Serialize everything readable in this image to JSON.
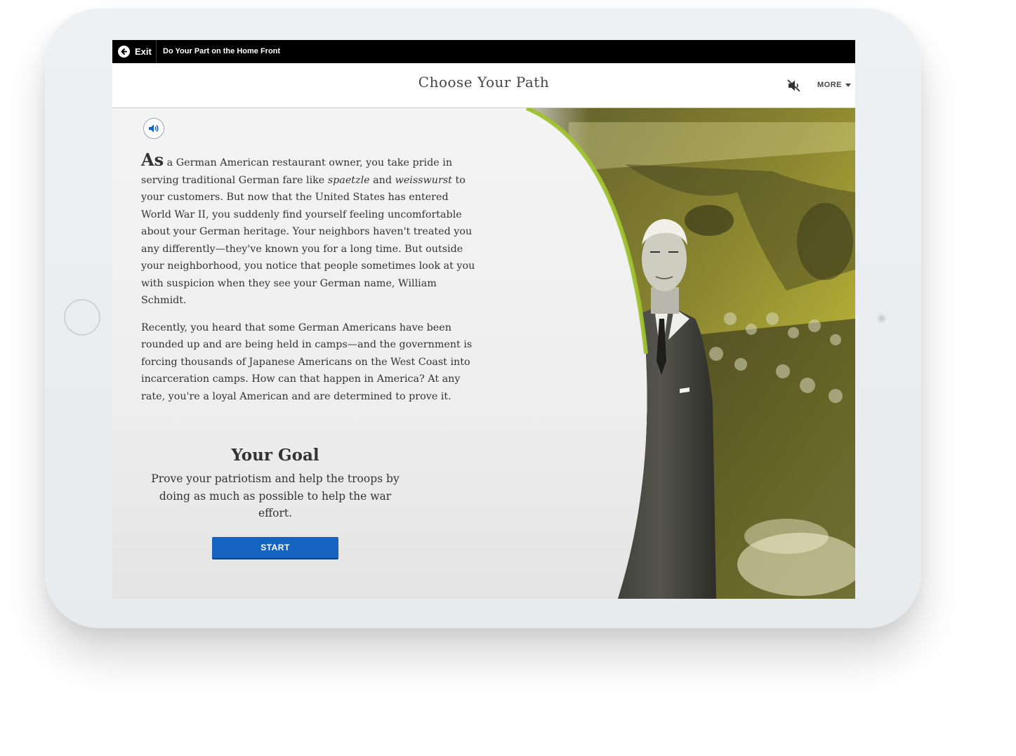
{
  "topbar": {
    "exit_label": "Exit",
    "lesson_title": "Do Your Part on the Home Front"
  },
  "header": {
    "title": "Choose Your Path",
    "more_label": "MORE"
  },
  "story": {
    "dropcap": "As",
    "p1_part1": " a German American restaurant owner, you take pride in serving traditional German fare like ",
    "p1_italic1": "spaetzle",
    "p1_and": " and ",
    "p1_italic2": "weisswurst",
    "p1_part2": " to your customers. But now that the United States has entered World War II, you suddenly find yourself feeling uncomfortable about your German heritage. Your neighbors haven't treated you any differently—they've known you for a long time. But outside your neighborhood, you notice that people sometimes look at you with suspicion when they see your German name, William Schmidt.",
    "p2": "Recently, you heard that some German Americans have been rounded up and are being held in camps—and the government is forcing thousands of Japanese Americans on the West Coast into incarceration camps. How can that happen in America? At any rate, you're a loyal American and are determined to prove it."
  },
  "goal": {
    "title": "Your Goal",
    "text": "Prove your patriotism and help the troops by doing as much as possible to help the war effort."
  },
  "start_label": "START",
  "icons": {
    "exit": "arrow-left-circle-icon",
    "mute": "speaker-muted-icon",
    "audio": "speaker-icon",
    "more": "caret-down-icon"
  },
  "colors": {
    "topbar": "#000000",
    "start_button": "#1564c0",
    "photo_tint": "#b9b52a",
    "accent_curve": "#9ec12f"
  }
}
